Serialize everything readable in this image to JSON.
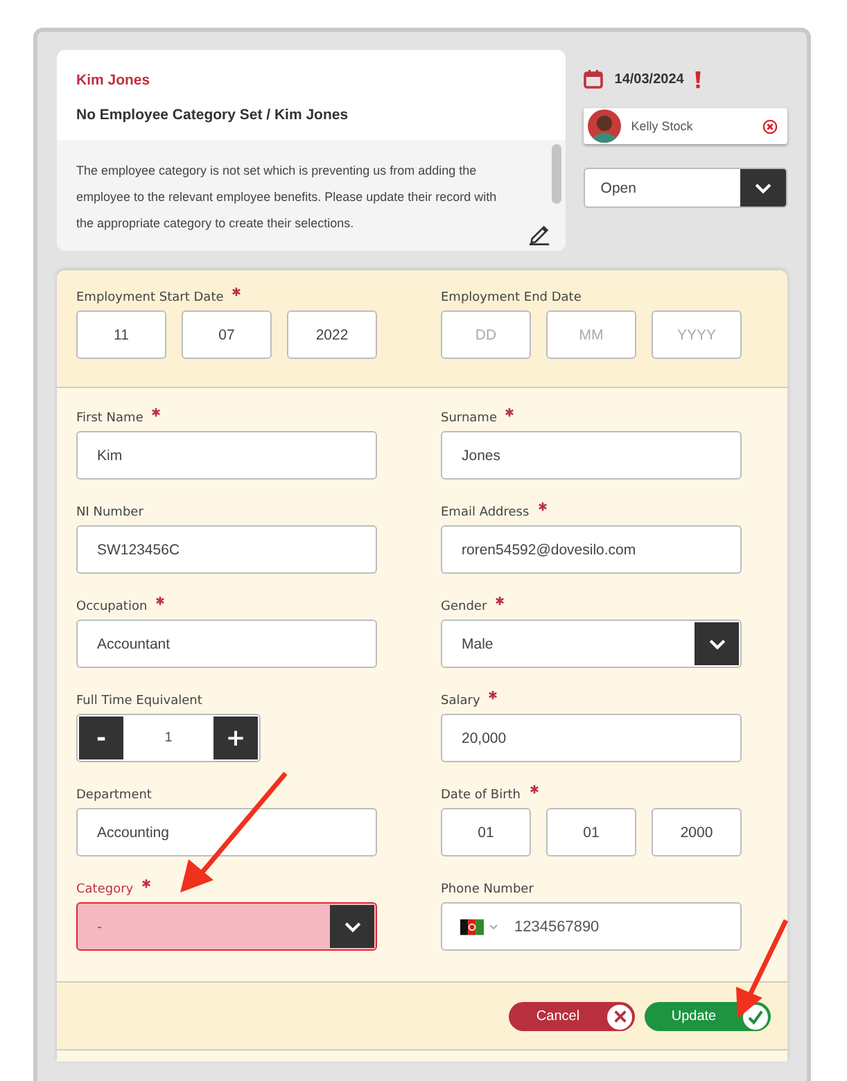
{
  "task": {
    "name": "Kim Jones",
    "title": "No Employee Category Set / Kim Jones",
    "message": "The employee category is not set which is preventing us from adding the employee to the relevant employee benefits. Please update their record with the appropriate category to create their selections.",
    "due_date": "14/03/2024",
    "overdue": true,
    "assignee": "Kelly Stock",
    "status": "Open"
  },
  "sections": [
    {
      "fields": [
        {
          "label": "Employment Start Date",
          "required": true,
          "kind": "date",
          "parts": [
            {
              "value": "11"
            },
            {
              "value": "07"
            },
            {
              "value": "2022"
            }
          ]
        },
        {
          "label": "Employment End Date",
          "required": false,
          "kind": "date",
          "parts": [
            {
              "placeholder": "DD"
            },
            {
              "placeholder": "MM"
            },
            {
              "placeholder": "YYYY"
            }
          ]
        }
      ]
    },
    {
      "fields": [
        {
          "label": "First Name",
          "required": true,
          "kind": "text",
          "value": "Kim"
        },
        {
          "label": "Surname",
          "required": true,
          "kind": "text",
          "value": "Jones"
        },
        {
          "label": "NI Number",
          "required": false,
          "kind": "text",
          "value": "SW123456C"
        },
        {
          "label": "Email Address",
          "required": true,
          "kind": "text",
          "value": "roren54592@dovesilo.com"
        },
        {
          "label": "Occupation",
          "required": true,
          "kind": "text",
          "value": "Accountant"
        },
        {
          "label": "Gender",
          "required": true,
          "kind": "select",
          "value": "Male",
          "error": false
        },
        {
          "label": "Full Time Equivalent",
          "required": false,
          "kind": "stepper",
          "value": "1",
          "minus": "-",
          "plus": "+"
        },
        {
          "label": "Salary",
          "required": true,
          "kind": "text",
          "value": "20,000"
        },
        {
          "label": "Department",
          "required": false,
          "kind": "text",
          "value": "Accounting"
        },
        {
          "label": "Date of Birth",
          "required": true,
          "kind": "date",
          "parts": [
            {
              "value": "01"
            },
            {
              "value": "01"
            },
            {
              "value": "2000"
            }
          ]
        },
        {
          "label": "Category",
          "required": true,
          "kind": "select",
          "value": "-",
          "error": true
        },
        {
          "label": "Phone Number",
          "required": false,
          "kind": "phone",
          "value": "1234567890"
        }
      ]
    }
  ],
  "buttons": [
    {
      "label": "Cancel",
      "kind": "cancel"
    },
    {
      "label": "Update",
      "kind": "confirm"
    }
  ]
}
